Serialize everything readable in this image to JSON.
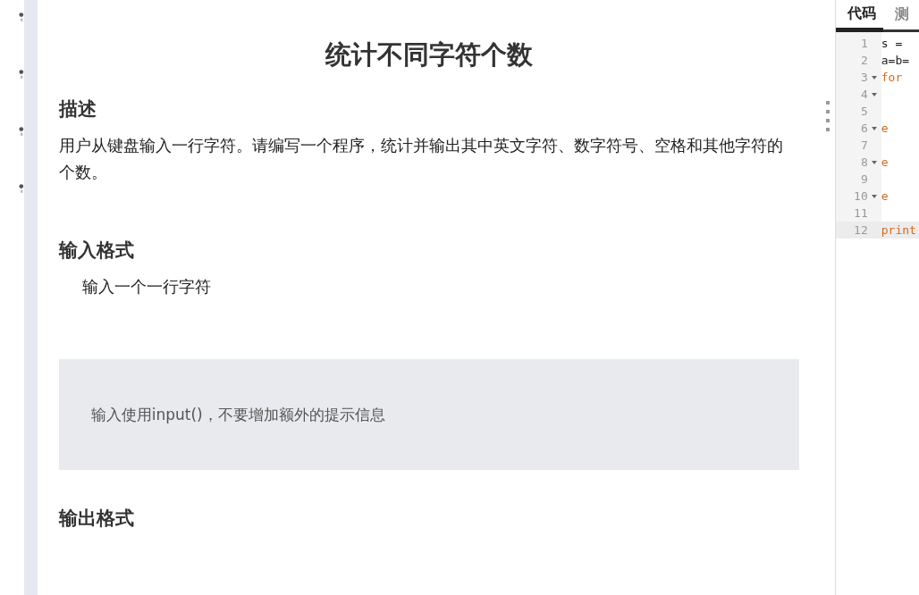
{
  "problem": {
    "title": "统计不同字符个数",
    "sections": [
      {
        "kind": "text",
        "heading": "描述",
        "body": "用户从键盘输入一行字符。请编写一个程序，统计并输出其中英文字符、数字符号、空格和其他字符的个数。"
      },
      {
        "kind": "indent",
        "heading": "输入格式",
        "body": "输入一个一行字符"
      },
      {
        "kind": "note",
        "body": "输入使用input()，不要增加额外的提示信息"
      },
      {
        "kind": "text",
        "heading": "输出格式"
      }
    ]
  },
  "editor": {
    "tabs": [
      {
        "label": "代码",
        "selected": true
      },
      {
        "label": "测",
        "selected": false
      }
    ],
    "lines": [
      {
        "number": "1",
        "code": "s =",
        "kind": "plain"
      },
      {
        "number": "2",
        "code": "a=b=",
        "kind": "plain"
      },
      {
        "number": "3",
        "code": "for",
        "foldable": true,
        "kind": "keyword"
      },
      {
        "number": "4",
        "foldable": true
      },
      {
        "number": "5"
      },
      {
        "number": "6",
        "code": "e",
        "foldable": true,
        "kind": "keyword"
      },
      {
        "number": "7"
      },
      {
        "number": "8",
        "code": "e",
        "foldable": true,
        "kind": "keyword"
      },
      {
        "number": "9"
      },
      {
        "number": "10",
        "code": "e",
        "foldable": true,
        "kind": "keyword"
      },
      {
        "number": "11"
      },
      {
        "number": "12",
        "code": "print",
        "kind": "keyword"
      }
    ]
  }
}
